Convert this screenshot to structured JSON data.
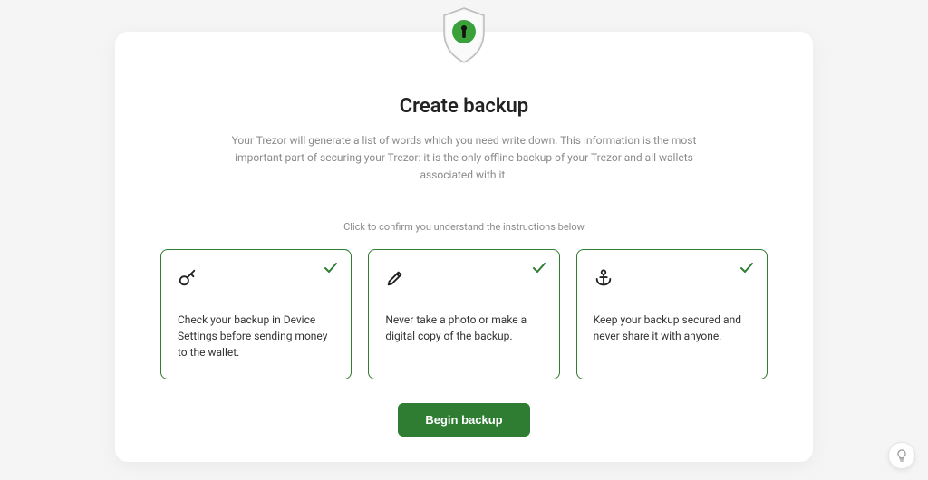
{
  "title": "Create backup",
  "description": "Your Trezor will generate a list of words which you need write down. This information is the most important part of securing your Trezor: it is the only offline backup of your Trezor and all wallets associated with it.",
  "instructions_label": "Click to confirm you understand the instructions below",
  "cards": [
    {
      "icon": "key-icon",
      "text": "Check your backup in Device Settings before sending money to the wallet.",
      "checked": true
    },
    {
      "icon": "pencil-icon",
      "text": "Never take a photo or make a digital copy of the backup.",
      "checked": true
    },
    {
      "icon": "anchor-icon",
      "text": "Keep your backup secured and never share it with anyone.",
      "checked": true
    }
  ],
  "begin_button": "Begin backup",
  "colors": {
    "accent": "#2e7d32",
    "bg": "#f5f5f5",
    "card_bg": "#ffffff",
    "text_muted": "#8a8a8a"
  }
}
